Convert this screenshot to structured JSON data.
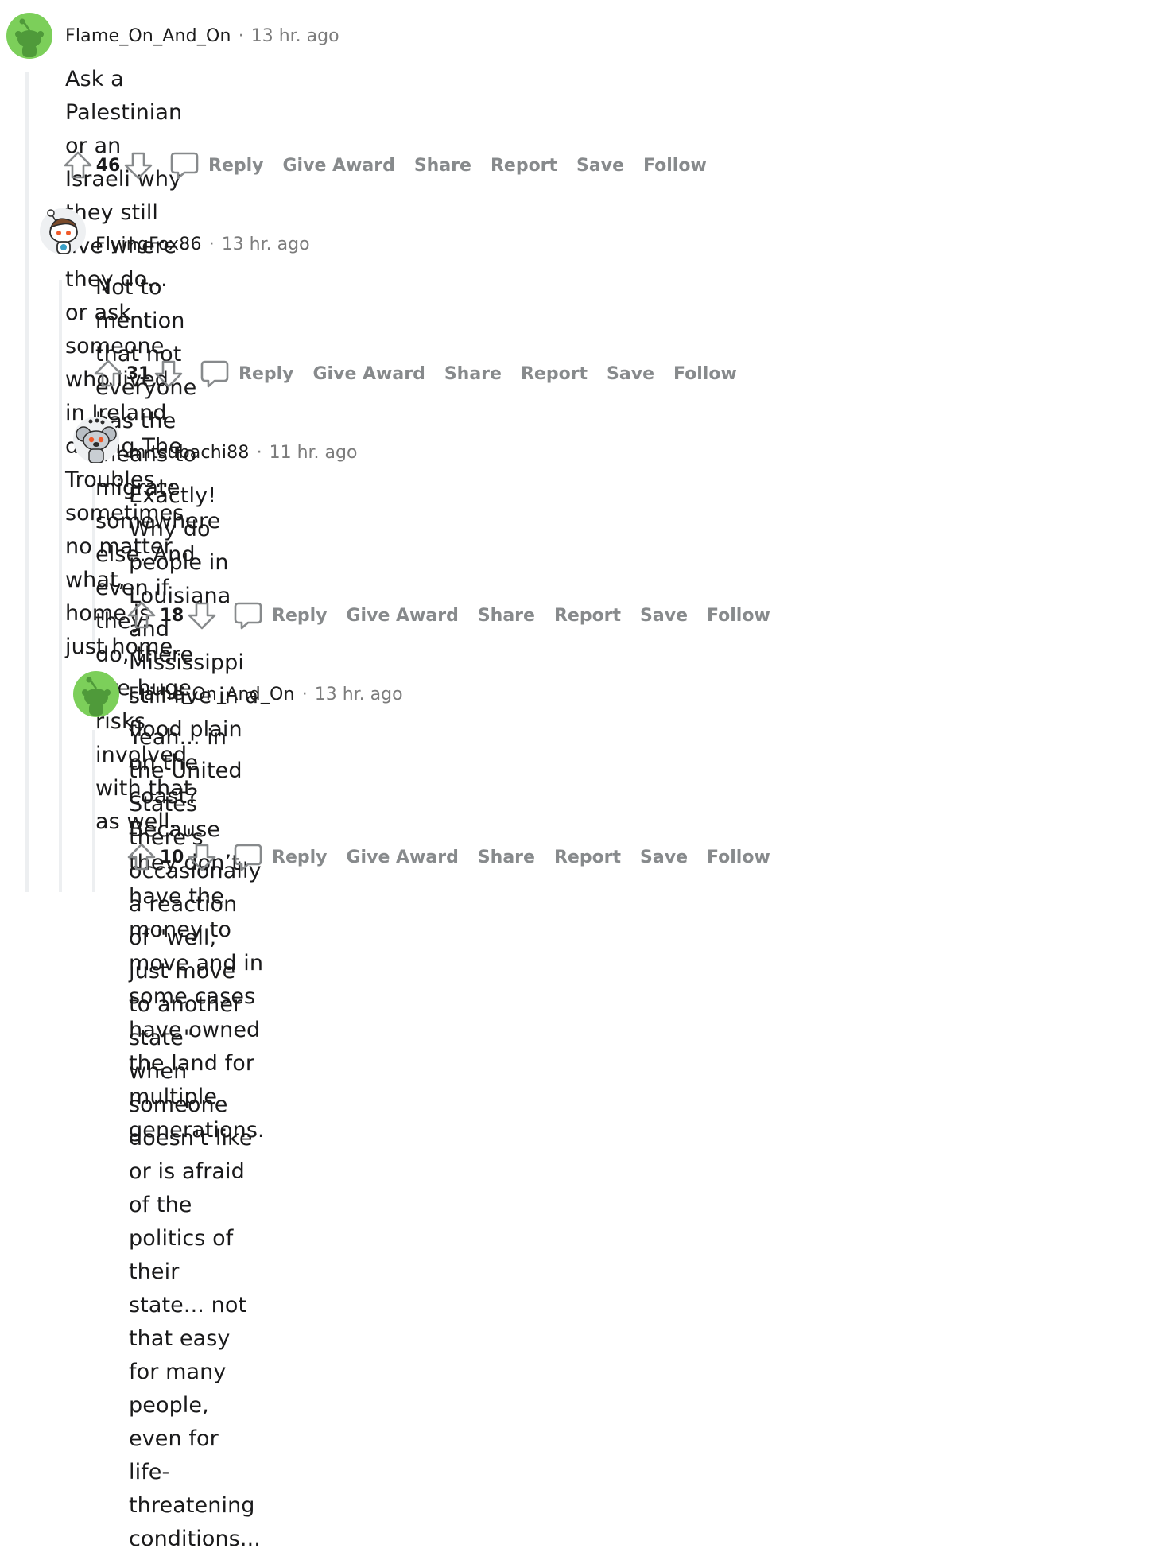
{
  "colors": {
    "thread_line": "#edeff1",
    "action_gray": "#878a8c",
    "meta_gray": "#7c7c7c",
    "avatar_green": "#7ccf5a"
  },
  "actions": {
    "reply": "Reply",
    "give_award": "Give Award",
    "share": "Share",
    "report": "Report",
    "save": "Save",
    "follow": "Follow"
  },
  "comments": [
    {
      "username": "Flame_On_And_On",
      "separator": "·",
      "timestamp": "13 hr. ago",
      "avatar_icon": "snoo-green-avatar-icon",
      "lines": [
        "Ask a Palestinian or an Israeli why they still live where they do... or ask someone who lived in Ireland",
        "during The Troubles... sometimes, no matter what, home is just home."
      ],
      "score": "46"
    },
    {
      "username": "FlyingFox86",
      "separator": "·",
      "timestamp": "13 hr. ago",
      "avatar_icon": "snoo-white-avatar-icon",
      "lines": [
        "Not to mention that not everyone has the means to migrate somewhere else. And even if they",
        "do, there are huge risks involved with that as well."
      ],
      "score": "31"
    },
    {
      "username": "mitsubachi88",
      "separator": "·",
      "timestamp": "11 hr. ago",
      "avatar_icon": "snoo-koala-avatar-icon",
      "lines": [
        "Exactly! Why do people in Louisiana and Mississippi still live in a flood plain on the coast?",
        "Because they don’t have the money to move and in some cases have owned the land for",
        "multiple generations."
      ],
      "score": "18"
    },
    {
      "username": "Flame_On_And_On",
      "separator": "·",
      "timestamp": "13 hr. ago",
      "avatar_icon": "snoo-green-avatar-icon",
      "lines": [
        "Yeah... in the United States there's occasionally a reaction of \"well, just move to another state\"",
        "when someone doesn't like or is afraid of the politics of their state... not that easy for many",
        "people, even for life-threatening conditions..."
      ],
      "score": "10"
    }
  ]
}
